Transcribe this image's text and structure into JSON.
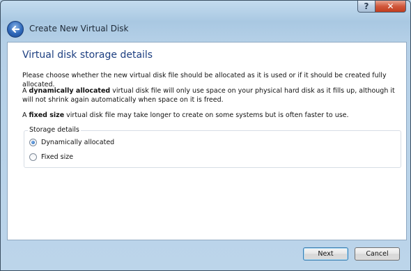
{
  "window": {
    "title": "Create New Virtual Disk",
    "help_label": "?",
    "close_label": "✕"
  },
  "page": {
    "title": "Virtual disk storage details",
    "intro": "Please choose whether the new virtual disk file should be allocated as it is used or if it should be created fully allocated.",
    "dynamic_prefix": "A ",
    "dynamic_bold": "dynamically allocated",
    "dynamic_rest": " virtual disk file will only use space on your physical hard disk as it fills up, although it will not shrink again automatically when space on it is freed.",
    "fixed_prefix": "A ",
    "fixed_bold": "fixed size",
    "fixed_rest": " virtual disk file may take longer to create on some systems but is often faster to use."
  },
  "storage": {
    "legend": "Storage details",
    "options": [
      {
        "label": "Dynamically allocated",
        "selected": true
      },
      {
        "label": "Fixed size",
        "selected": false
      }
    ]
  },
  "buttons": {
    "next": "Next",
    "cancel": "Cancel"
  },
  "icons": {
    "back": "back-arrow-icon"
  }
}
